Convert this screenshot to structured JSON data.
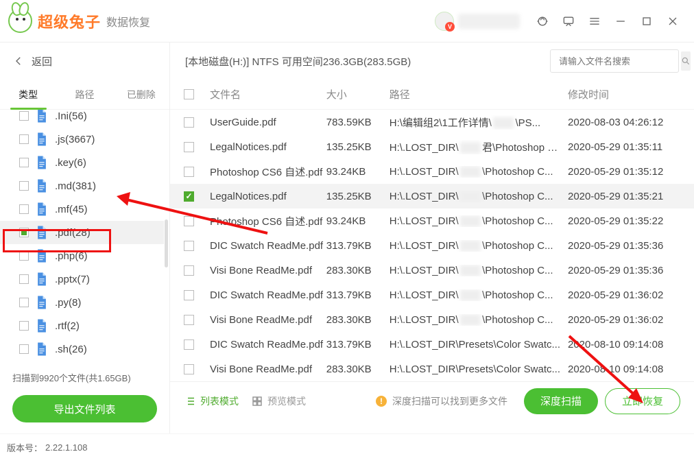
{
  "app": {
    "brand": "超级兔子",
    "subtitle": "数据恢复",
    "user_badge": "V",
    "version_label": "版本号：",
    "version": "2.22.1.108"
  },
  "sidebar": {
    "back": "返回",
    "tabs": [
      "类型",
      "路径",
      "已删除"
    ],
    "active_tab": 0,
    "items": [
      {
        "label": ".Ini(56)",
        "indeterminate": false
      },
      {
        "label": ".js(3667)",
        "indeterminate": false
      },
      {
        "label": ".key(6)",
        "indeterminate": false
      },
      {
        "label": ".md(381)",
        "indeterminate": false
      },
      {
        "label": ".mf(45)",
        "indeterminate": false
      },
      {
        "label": ".pdf(28)",
        "indeterminate": true,
        "highlight": true
      },
      {
        "label": ".php(6)",
        "indeterminate": false
      },
      {
        "label": ".pptx(7)",
        "indeterminate": false
      },
      {
        "label": ".py(8)",
        "indeterminate": false
      },
      {
        "label": ".rtf(2)",
        "indeterminate": false
      },
      {
        "label": ".sh(26)",
        "indeterminate": false
      }
    ],
    "scan_status": "扫描到9920个文件(共1.65GB)",
    "export_btn": "导出文件列表"
  },
  "main": {
    "breadcrumb": "[本地磁盘(H:)] NTFS 可用空间236.3GB(283.5GB)",
    "search_placeholder": "请输入文件名搜索",
    "columns": {
      "name": "文件名",
      "size": "大小",
      "path": "路径",
      "date": "修改时间"
    },
    "rows": [
      {
        "name": "UserGuide.pdf",
        "size": "783.59KB",
        "path_pre": "H:\\编辑组2\\1工作详情\\",
        "path_blur": "xxx",
        "path_post": "\\PS...",
        "date": "2020-08-03 04:26:12",
        "selected": false
      },
      {
        "name": "LegalNotices.pdf",
        "size": "135.25KB",
        "path_pre": "H:\\.LOST_DIR\\",
        "path_blur": "xxx",
        "path_post": "君\\Photoshop C...",
        "date": "2020-05-29 01:35:11",
        "selected": false
      },
      {
        "name": "Photoshop CS6 自述.pdf",
        "size": "93.24KB",
        "path_pre": "H:\\.LOST_DIR\\",
        "path_blur": "xxx",
        "path_post": "\\Photoshop C...",
        "date": "2020-05-29 01:35:12",
        "selected": false
      },
      {
        "name": "LegalNotices.pdf",
        "size": "135.25KB",
        "path_pre": "H:\\.LOST_DIR\\",
        "path_blur": "xxx",
        "path_post": "\\Photoshop C...",
        "date": "2020-05-29 01:35:21",
        "selected": true
      },
      {
        "name": "Photoshop CS6 自述.pdf",
        "size": "93.24KB",
        "path_pre": "H:\\.LOST_DIR\\",
        "path_blur": "xxx",
        "path_post": "\\Photoshop C...",
        "date": "2020-05-29 01:35:22",
        "selected": false
      },
      {
        "name": "DIC Swatch ReadMe.pdf",
        "size": "313.79KB",
        "path_pre": "H:\\.LOST_DIR\\",
        "path_blur": "xxx",
        "path_post": "\\Photoshop C...",
        "date": "2020-05-29 01:35:36",
        "selected": false
      },
      {
        "name": "Visi Bone ReadMe.pdf",
        "size": "283.30KB",
        "path_pre": "H:\\.LOST_DIR\\",
        "path_blur": "xxx",
        "path_post": "\\Photoshop C...",
        "date": "2020-05-29 01:35:36",
        "selected": false
      },
      {
        "name": "DIC Swatch ReadMe.pdf",
        "size": "313.79KB",
        "path_pre": "H:\\.LOST_DIR\\",
        "path_blur": "xxx",
        "path_post": "\\Photoshop C...",
        "date": "2020-05-29 01:36:02",
        "selected": false
      },
      {
        "name": "Visi Bone ReadMe.pdf",
        "size": "283.30KB",
        "path_pre": "H:\\.LOST_DIR\\",
        "path_blur": "xxx",
        "path_post": "\\Photoshop C...",
        "date": "2020-05-29 01:36:02",
        "selected": false
      },
      {
        "name": "DIC Swatch ReadMe.pdf",
        "size": "313.79KB",
        "path_pre": "H:\\.LOST_DIR\\Presets\\Color Swatc...",
        "path_blur": "",
        "path_post": "",
        "date": "2020-08-10 09:14:08",
        "selected": false
      },
      {
        "name": "Visi Bone ReadMe.pdf",
        "size": "283.30KB",
        "path_pre": "H:\\.LOST_DIR\\Presets\\Color Swatc...",
        "path_blur": "",
        "path_post": "",
        "date": "2020-08-10 09:14:08",
        "selected": false
      }
    ]
  },
  "footer": {
    "list_mode": "列表模式",
    "preview_mode": "预览模式",
    "deep_tip": "深度扫描可以找到更多文件",
    "deep_scan_btn": "深度扫描",
    "recover_btn": "立即恢复"
  }
}
